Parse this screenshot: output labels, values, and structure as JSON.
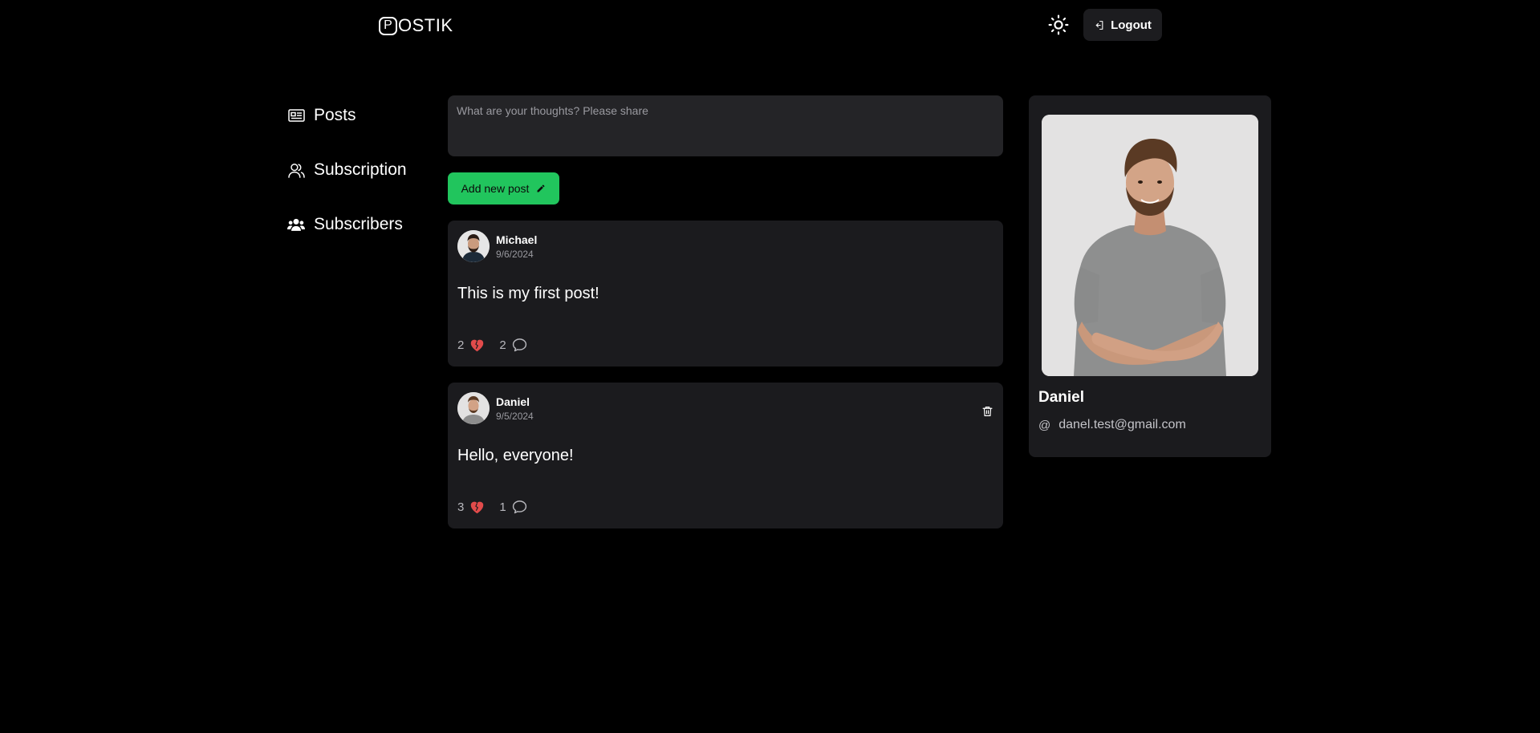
{
  "header": {
    "logo_text": "OSTIK",
    "logo_mark": "P",
    "logout_label": "Logout"
  },
  "sidebar": {
    "items": [
      {
        "label": "Posts",
        "icon": "newspaper-icon"
      },
      {
        "label": "Subscription",
        "icon": "user-icon"
      },
      {
        "label": "Subscribers",
        "icon": "users-icon"
      }
    ]
  },
  "composer": {
    "placeholder": "What are your thoughts? Please share",
    "value": ""
  },
  "add_post": {
    "label": "Add new post"
  },
  "posts": [
    {
      "author": "Michael",
      "date": "9/6/2024",
      "content": "This is my first post!",
      "likes": "2",
      "comments": "2",
      "can_delete": false
    },
    {
      "author": "Daniel",
      "date": "9/5/2024",
      "content": "Hello, everyone!",
      "likes": "3",
      "comments": "1",
      "can_delete": true
    }
  ],
  "profile": {
    "name": "Daniel",
    "email": "danel.test@gmail.com"
  },
  "colors": {
    "accent": "#21c55d",
    "background": "#000000",
    "card": "#1b1b1e",
    "like": "#e24b4b"
  }
}
